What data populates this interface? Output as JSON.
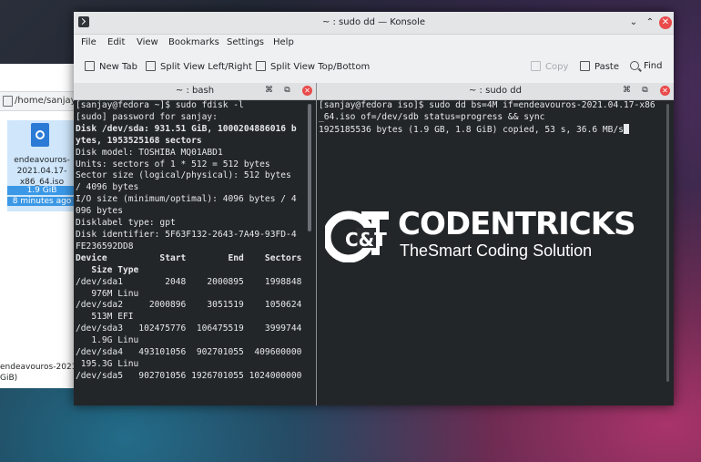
{
  "file_manager": {
    "path": "/home/sanjay",
    "file_name": "endeavouros-2021.04.17-x86_64.iso",
    "file_size": "1.9 GiB",
    "file_age": "8 minutes ago",
    "bottom_name": "endeavouros-2021",
    "bottom_size": "GiB)"
  },
  "window": {
    "title": "~ : sudo dd — Konsole",
    "min_glyph": "⌄",
    "max_glyph": "⌃",
    "close_glyph": "✕"
  },
  "menu": [
    "File",
    "Edit",
    "View",
    "Bookmarks",
    "Settings",
    "Help"
  ],
  "toolbar": {
    "new_tab": "New Tab",
    "split_lr": "Split View Left/Right",
    "split_tb": "Split View Top/Bottom",
    "copy": "Copy",
    "paste": "Paste",
    "find": "Find"
  },
  "left_tab": {
    "label": "~ : bash"
  },
  "right_tab": {
    "label": "~ : sudo dd"
  },
  "left_terminal": [
    "[sanjay@fedora ~]$ sudo fdisk -l",
    "[sudo] password for sanjay:",
    "Disk /dev/sda: 931.51 GiB, 1000204886016 b",
    "ytes, 1953525168 sectors",
    "Disk model: TOSHIBA MQ01ABD1",
    "Units: sectors of 1 * 512 = 512 bytes",
    "Sector size (logical/physical): 512 bytes",
    "/ 4096 bytes",
    "I/O size (minimum/optimal): 4096 bytes / 4",
    "096 bytes",
    "Disklabel type: gpt",
    "Disk identifier: 5F63F132-2643-7A49-93FD-4",
    "FE236592DD8",
    "",
    "Device          Start        End    Sectors",
    "   Size Type",
    "/dev/sda1        2048    2000895    1998848",
    "   976M Linu",
    "/dev/sda2     2000896    3051519    1050624",
    "   513M EFI",
    "/dev/sda3   102475776  106475519    3999744",
    "   1.9G Linu",
    "/dev/sda4   493101056  902701055  409600000",
    " 195.3G Linu",
    "/dev/sda5   902701056 1926701055 1024000000"
  ],
  "right_terminal": [
    "[sanjay@fedora iso]$ sudo dd bs=4M if=endeavouros-2021.04.17-x86",
    "_64.iso of=/dev/sdb status=progress && sync",
    "1925185536 bytes (1.9 GB, 1.8 GiB) copied, 53 s, 36.6 MB/s"
  ],
  "watermark": {
    "logo_text": "C&T",
    "brand": "CODENTRICKS",
    "tagline": "TheSmart Coding Solution"
  }
}
